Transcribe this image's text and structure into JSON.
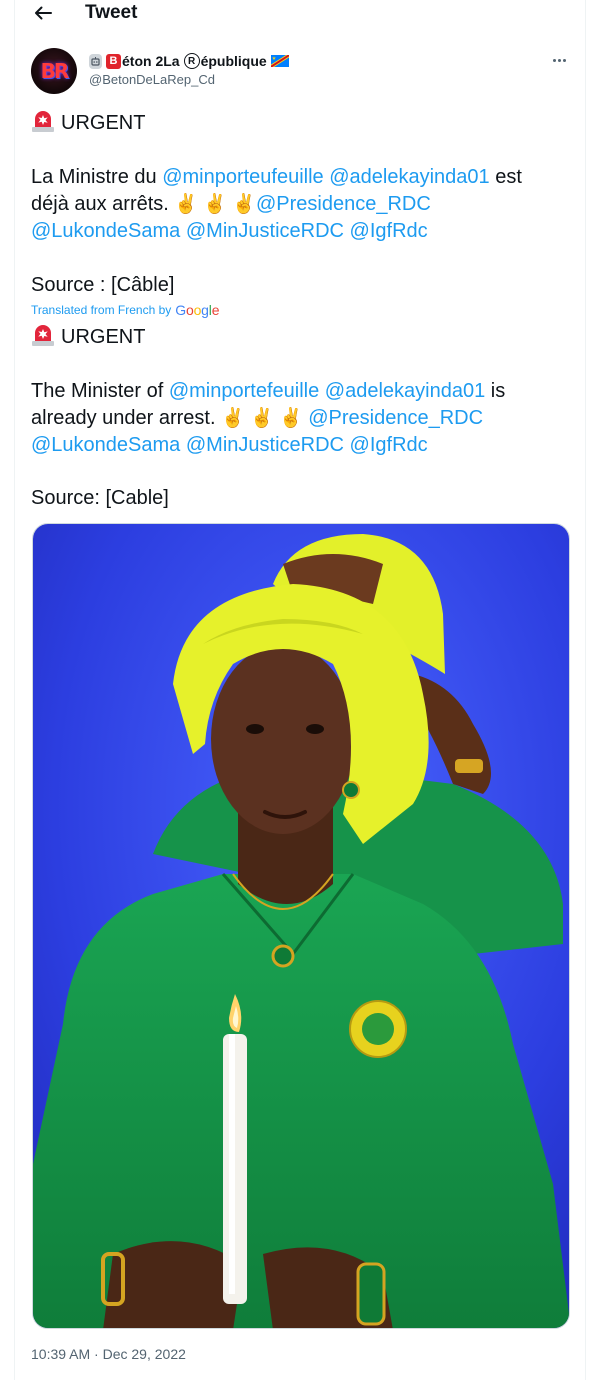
{
  "header": {
    "title": "Tweet"
  },
  "author": {
    "name_text": "éton 2La",
    "name_text2": "épublique",
    "box_letter": "B",
    "circled_letter": "R",
    "handle": "@BetonDeLaRep_Cd",
    "avatar_text": "BR"
  },
  "tweet": {
    "original": {
      "urgent": "URGENT",
      "line1_pre": "La Ministre du",
      "mention1": "@minporteufeuille",
      "mention2": "@adelekayinda01",
      "line1_post": "est",
      "line2_pre": "déjà aux arrêts.",
      "peace": "✌️ ✌️ ✌️",
      "mention3": "@Presidence_RDC",
      "mention4": "@LukondeSama",
      "mention5": "@MinJusticeRDC",
      "mention6": "@IgfRdc",
      "source": "Source : [Câble]"
    },
    "translated_label": "Translated from French by",
    "google": {
      "G": "G",
      "o1": "o",
      "o2": "o",
      "g": "g",
      "l": "l",
      "e": "e"
    },
    "translation": {
      "urgent": "URGENT",
      "line1_pre": "The Minister of",
      "mention1": "@minportefeuille",
      "mention2": "@adelekayinda01",
      "line1_post": "is",
      "line2_pre": "already under arrest.",
      "peace": "✌️ ✌️ ✌️",
      "mention3": "@Presidence_RDC",
      "mention4": "@LukondeSama",
      "mention5": "@MinJusticeRDC",
      "mention6": "@IgfRdc",
      "source": "Source: [Cable]"
    },
    "time": "10:39 AM",
    "separator": "·",
    "date": "Dec 29, 2022"
  },
  "colors": {
    "link": "#1d9bf0",
    "secondary_text": "#536471",
    "photo_background": "#2f3fe0",
    "scarf": "#e4f02a",
    "dress": "#159447"
  },
  "icons": [
    "back-arrow-icon",
    "more-icon",
    "siren-icon",
    "victory-hand-icon",
    "drc-flag-icon"
  ]
}
